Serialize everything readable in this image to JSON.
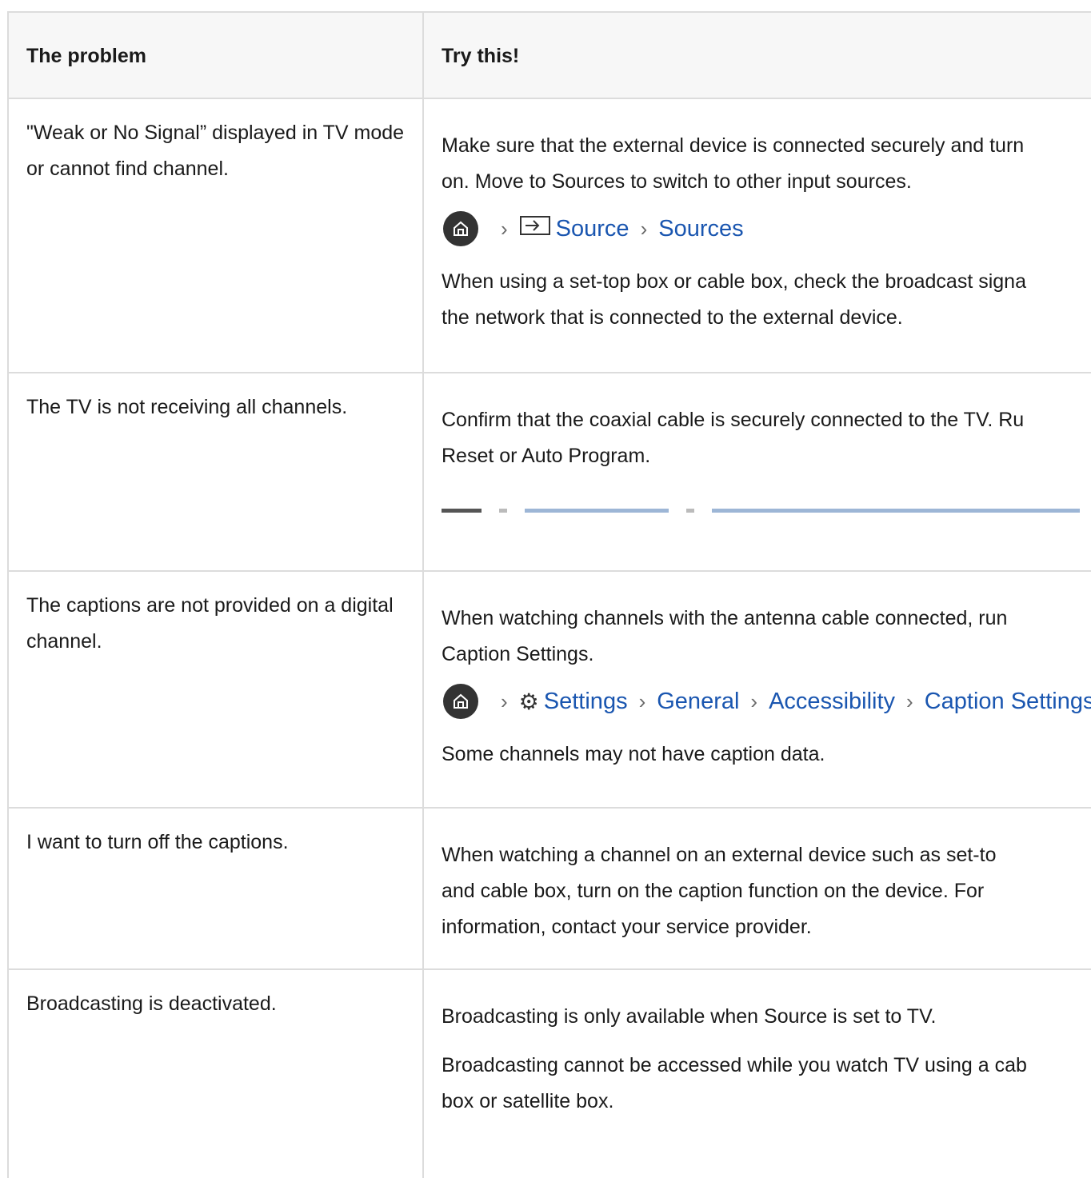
{
  "header": {
    "col1": "The problem",
    "col2": "Try this!"
  },
  "rows": [
    {
      "problem": "\"Weak or No Signal” displayed in TV mode or cannot find channel.",
      "p1": "Make sure that the external device is connected securely and turn",
      "p1b": "on. Move to Sources to switch to other input sources.",
      "path": [
        "Source",
        "Sources"
      ],
      "p2": "When using a set-top box or cable box, check the broadcast signa",
      "p2b": "the network that is connected to the external device."
    },
    {
      "problem": "The TV is not receiving all channels.",
      "p1": "Confirm that the coaxial cable is securely connected to the TV. Ru",
      "p1b": "Reset or Auto Program."
    },
    {
      "problem": "The captions are not provided on a digital channel.",
      "p1": "When watching channels with the antenna cable connected, run",
      "p1b": "Caption Settings.",
      "path": [
        "Settings",
        "General",
        "Accessibility",
        "Caption Settings"
      ],
      "p2": "Some channels may not have caption data."
    },
    {
      "problem": "I want to turn off the captions.",
      "p1": "When watching a channel on an external device such as set-to",
      "p1b": "and cable box, turn on the caption function on the device. For",
      "p1c": "information, contact your service provider."
    },
    {
      "problem": "Broadcasting is deactivated.",
      "p1": "Broadcasting is only available when Source is set to TV.",
      "p2": "Broadcasting cannot be accessed while you watch TV using a cab",
      "p2b": "box or satellite box."
    }
  ],
  "icons": {
    "home": "home-icon",
    "source": "source-input-icon",
    "settings": "gear-icon",
    "chevron": "chevron-right-icon"
  },
  "colors": {
    "link": "#1a56b0",
    "border": "#dcdcdc",
    "header_bg": "#f7f7f7"
  }
}
